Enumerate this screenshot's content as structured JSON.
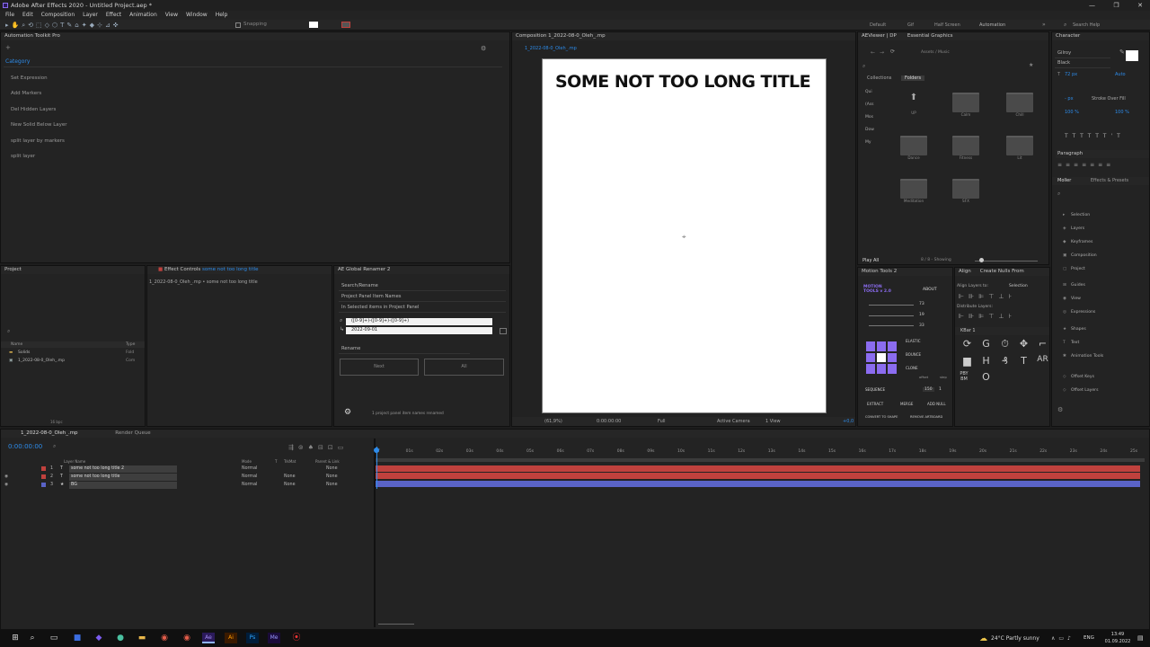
{
  "window": {
    "title": "Adobe After Effects 2020 - Untitled Project.aep *",
    "controls": [
      "—",
      "❐",
      "✕"
    ]
  },
  "menu": [
    "File",
    "Edit",
    "Composition",
    "Layer",
    "Effect",
    "Animation",
    "View",
    "Window",
    "Help"
  ],
  "toolbar": {
    "snapping": "Snapping",
    "workspaces": [
      "Default",
      "Gif",
      "Half Screen",
      "Automation"
    ],
    "more": "»",
    "search": "Search Help"
  },
  "toolkit": {
    "title": "Automation Toolkit Pro",
    "category": "Category",
    "items": [
      "Set Expression",
      "Add Markers",
      "Del Hidden Layers",
      "New Solid Below Layer",
      "split layer by markers",
      "split layer"
    ]
  },
  "comp": {
    "tab": "Composition 1_2022-08-0_Oleh_.mp",
    "subtab": "1_2022-08-0_Oleh_.mp",
    "title": "SOME NOT TOO LONG TITLE",
    "footer": {
      "zoom": "(61,9%)",
      "time": "0:00:00:00",
      "res": "Full",
      "camera": "Active Camera",
      "views": "1 View",
      "offset": "+0,0"
    }
  },
  "aeviewer": {
    "tabs": [
      "AEViewer | DP",
      "Essential Graphics"
    ],
    "breadcrumb": "Assets / Music",
    "subtabs": [
      "Collections",
      "Folders"
    ],
    "side": [
      "Qui",
      "(Ass",
      "Mos",
      "Dow",
      "My"
    ],
    "folders": [
      "UP",
      "Calm",
      "Chill",
      "Dance",
      "Fitness",
      "Lit",
      "Meditation",
      "SFX"
    ],
    "playall": "Play All",
    "showing": "8 / 8 - Showing"
  },
  "project": {
    "title": "Project",
    "cols": [
      "Name",
      "Type"
    ],
    "items": [
      {
        "name": "Solids",
        "type": "Fold"
      },
      {
        "name": "1_2022-08-0_Oleh_.mp",
        "type": "Com"
      }
    ],
    "bpc": "16 bpc"
  },
  "effects": {
    "title": "Effect Controls",
    "layer": "some not too long title",
    "path": "1_2022-08-0_Oleh_.mp • some not too long title"
  },
  "renamer": {
    "title": "AE Global Renamer 2",
    "mode": "Search/Rename",
    "target": "Project Panel Item Names",
    "scope": "In Selected items in Project Panel",
    "find": "([0-9]+)-([0-9]+)-([0-9]+)",
    "replace": "2022-09-01",
    "action": "Rename",
    "btn_next": "Next",
    "btn_all": "All",
    "status": "1 project panel item names renamed"
  },
  "character": {
    "title": "Character",
    "font": "Gilroy",
    "style": "Black",
    "size": "72 px",
    "auto": "Auto",
    "stroke_px": "- px",
    "stroke": "Stroke Over Fill",
    "h": "100 %",
    "v": "100 %"
  },
  "paragraph": {
    "title": "Paragraph"
  },
  "moller": {
    "tabs": [
      "Moller",
      "Effects & Presets"
    ],
    "items": [
      "Selection",
      "Layers",
      "Keyframes",
      "Composition",
      "Project",
      "Guides",
      "View",
      "Expressions",
      "Shapes",
      "Text",
      "Animation Tools",
      "Offset Keys",
      "Offset Layers"
    ]
  },
  "motion": {
    "title": "Motion Tools 2",
    "brand": "MOTION TOOLS v 2.0",
    "about": "ABOUT",
    "values": [
      "73",
      "19",
      "33"
    ],
    "elastic": "ELASTIC",
    "bounce": "BOUNCE",
    "clone": "CLONE",
    "offset": "offset",
    "step": "step",
    "offset_val": "150",
    "step_val": "1",
    "sequence": "SEQUENCE",
    "extract": "EXTRACT",
    "merge": "MERGE",
    "addnull": "ADD NULL",
    "convert": "CONVERT TO SHAPE",
    "remove": "REMOVE ARTBOARD"
  },
  "align": {
    "tabs": [
      "Align",
      "Create Nulls From"
    ],
    "alignto": "Align Layers to:",
    "selection": "Selection",
    "distribute": "Distribute Layers:"
  },
  "kbar": {
    "title": "KBar 1",
    "glyphs": [
      "⟳",
      "G",
      "⏱",
      "✥",
      "⌐",
      "▆",
      "H",
      "₰",
      "T",
      "AR",
      "PBY BM",
      "O"
    ]
  },
  "timeline": {
    "tab": "1_2022-08-0_Oleh_.mp",
    "tab2": "Render Queue",
    "time": "0:00:00:00",
    "cols": [
      "Layer Name",
      "Mode",
      "T",
      "TrkMat",
      "Parent & Link"
    ],
    "layers": [
      {
        "n": "1",
        "name": "some not too long title 2",
        "mode": "Normal",
        "trk": "",
        "parent": "None",
        "color": "#c0413d"
      },
      {
        "n": "2",
        "name": "some not too long title",
        "mode": "Normal",
        "trk": "None",
        "parent": "None",
        "color": "#c0413d"
      },
      {
        "n": "3",
        "name": "BG",
        "mode": "Normal",
        "trk": "None",
        "parent": "None",
        "color": "#5a63c7"
      }
    ],
    "ticks": [
      "0f",
      "01s",
      "02s",
      "03s",
      "04s",
      "05s",
      "06s",
      "07s",
      "08s",
      "09s",
      "10s",
      "11s",
      "12s",
      "13s",
      "14s",
      "15s",
      "16s",
      "17s",
      "18s",
      "19s",
      "20s",
      "21s",
      "22s",
      "23s",
      "24s",
      "25s"
    ]
  },
  "taskbar": {
    "weather": "24°C  Partly sunny",
    "lang": "ENG",
    "clock": "13:49",
    "date": "01.09.2022"
  },
  "colors": {
    "accent": "#2d8ceb",
    "red_layer": "#c0413d",
    "blue_layer": "#5a63c7",
    "purple": "#8b6cf0"
  }
}
